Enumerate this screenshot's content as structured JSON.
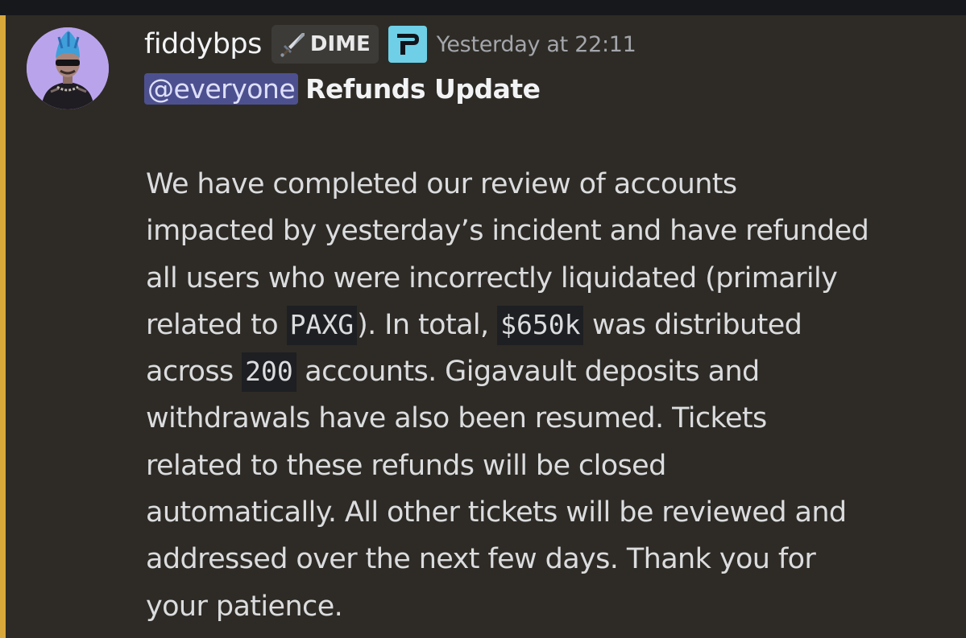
{
  "author": {
    "username": "fiddybps",
    "tag": {
      "icon": "sword-icon",
      "label": "DIME"
    },
    "badge_icon": "paradex-logo-icon",
    "timestamp": "Yesterday at 22:11"
  },
  "message": {
    "mention": "@everyone",
    "title": "Refunds Update",
    "body": {
      "line1": "We have completed our review of accounts",
      "line2": "impacted by yesterday’s incident and have refunded",
      "line3": "all users who were incorrectly liquidated (primarily",
      "line4_a": "related to ",
      "line4_code1": "PAXG",
      "line4_b": "). In total, ",
      "line4_code2": "$650k",
      "line4_c": " was distributed",
      "line5_a": "across ",
      "line5_code": "200",
      "line5_b": " accounts. Gigavault deposits and",
      "line6": "withdrawals have also been resumed. Tickets",
      "line7": "related to these refunds will be closed",
      "line8": "automatically. All other tickets will be reviewed and",
      "line9": "addressed over the next few days. Thank you for",
      "line10": "your patience."
    }
  },
  "colors": {
    "background": "#2e2b26",
    "accent_bar": "#d9a83a",
    "mention_bg": "#4d508f",
    "badge_bg": "#6ecfe6"
  }
}
